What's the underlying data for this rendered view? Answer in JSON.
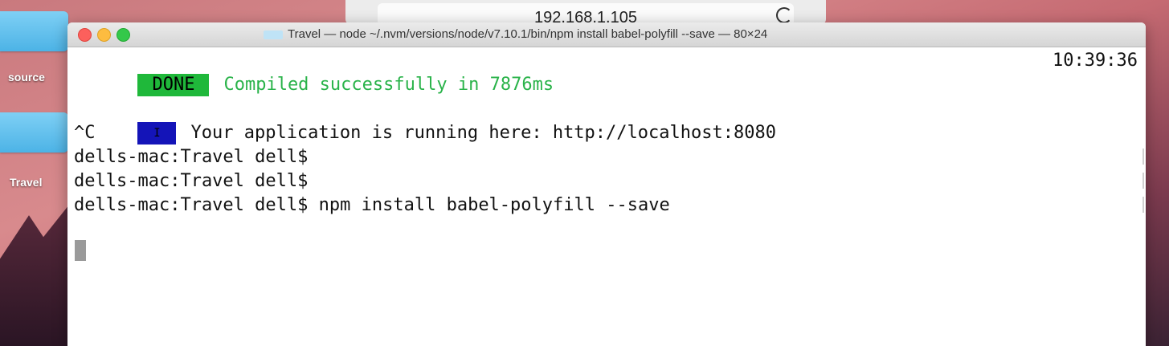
{
  "desktop": {
    "items": [
      {
        "label": "source"
      },
      {
        "label": "Travel"
      }
    ]
  },
  "browser": {
    "address": "192.168.1.105"
  },
  "terminal": {
    "title": "Travel — node ~/.nvm/versions/node/v7.10.1/bin/npm install babel-polyfill --save — 80×24",
    "time": "10:39:36",
    "done_badge": "DONE",
    "compiled_message": "Compiled successfully in 7876ms",
    "info_badge": "I",
    "running_message": "Your application is running here: http://localhost:8080",
    "lines": [
      "^C",
      "dells-mac:Travel dell$",
      "dells-mac:Travel dell$",
      "dells-mac:Travel dell$ npm install babel-polyfill --save"
    ]
  },
  "colors": {
    "done_bg": "#1fb83a",
    "success_text": "#2ab34a",
    "info_bg": "#1414b8"
  }
}
